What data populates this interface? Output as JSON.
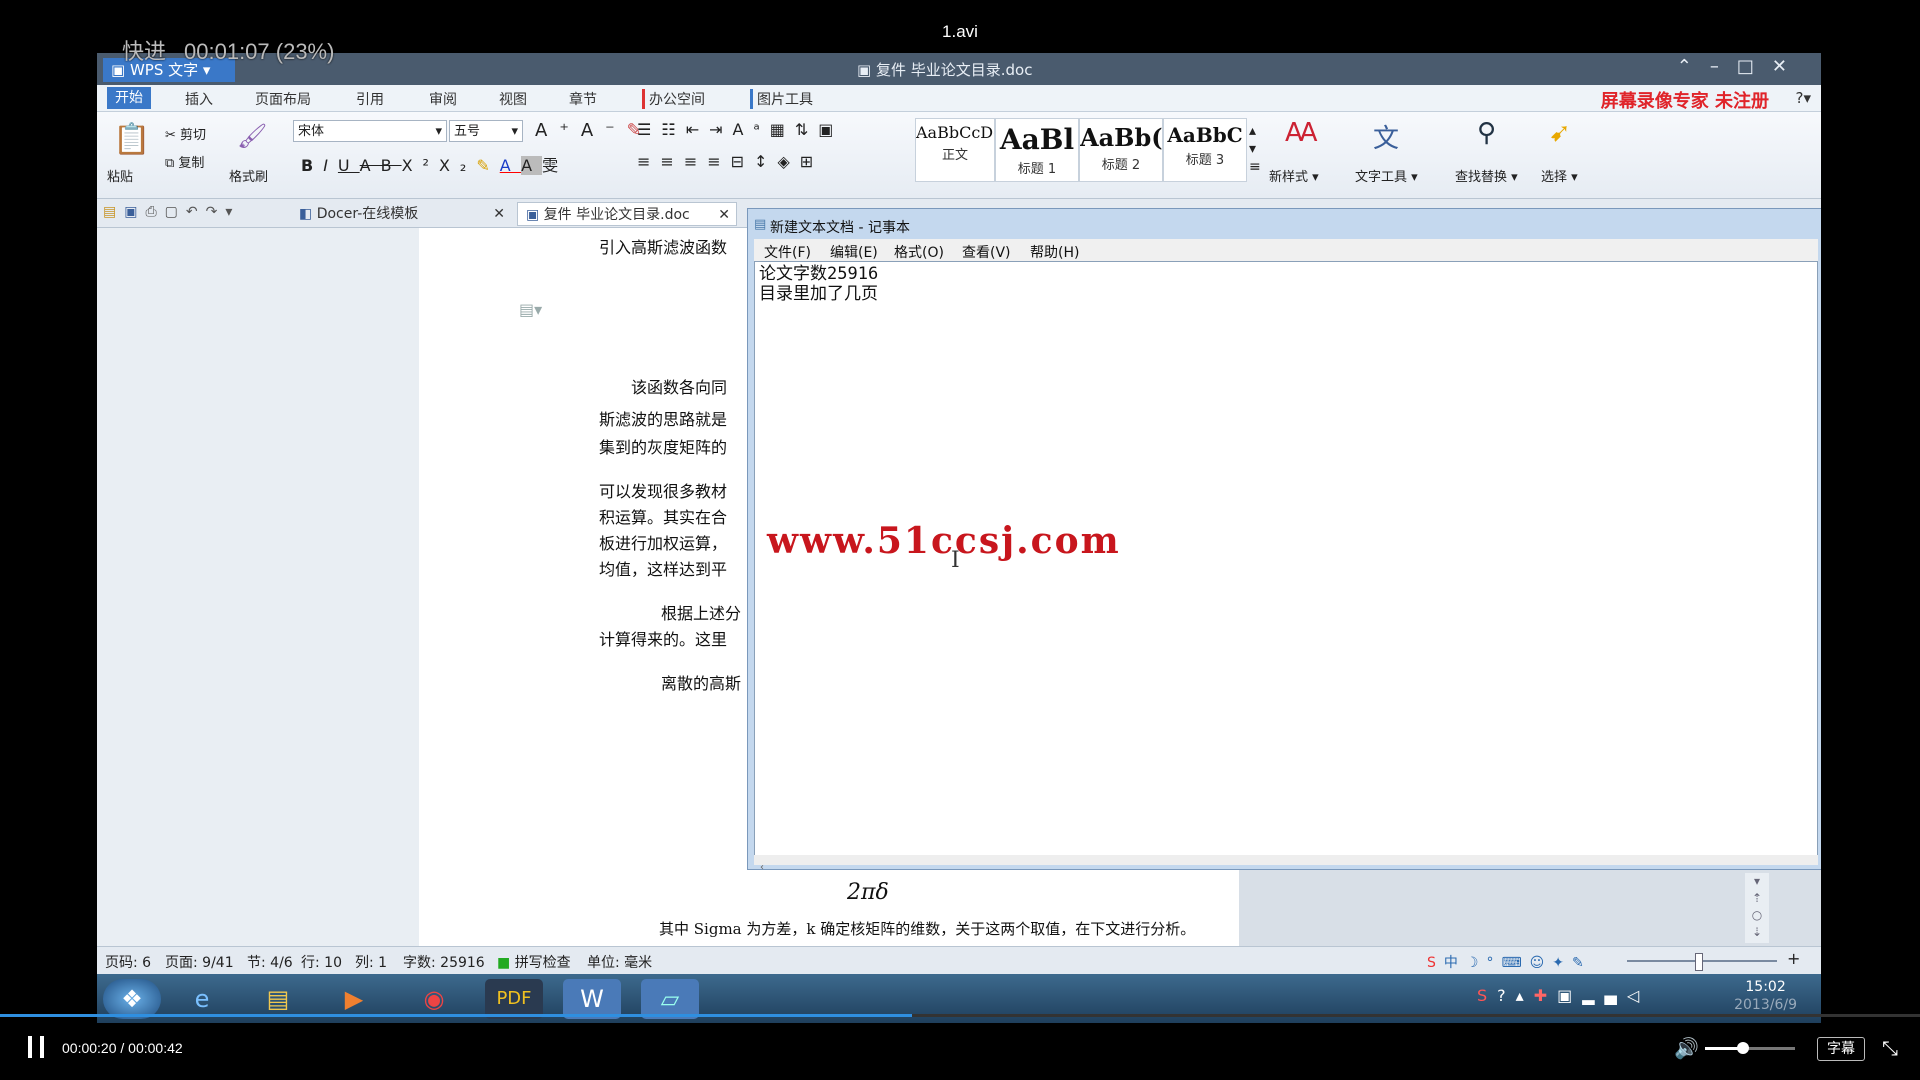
{
  "player": {
    "file_name": "1.avi",
    "speed_label": "快进",
    "speed_time": "00:01:07 (23%)",
    "timecode": "00:00:20 / 00:00:42",
    "progress": 0.475,
    "volume": 0.42,
    "subtitle_label": "字幕"
  },
  "app": {
    "name": "WPS 文字",
    "doc_title": "复件 毕业论文目录.doc",
    "red_banner": "屏幕录像专家 未注册",
    "menus": [
      "开始",
      "插入",
      "页面布局",
      "引用",
      "审阅",
      "视图",
      "章节",
      "办公空间",
      "图片工具"
    ]
  },
  "ribbon": {
    "paste": "粘贴",
    "cut": "剪切",
    "copy": "复制",
    "format_painter": "格式刷",
    "font_name": "宋体",
    "font_size": "五号",
    "styles": [
      {
        "sample": "AaBbCcDd",
        "label": "正文"
      },
      {
        "sample": "AaBl",
        "label": "标题 1"
      },
      {
        "sample": "AaBb(",
        "label": "标题 2"
      },
      {
        "sample": "AaBbC",
        "label": "标题 3"
      }
    ],
    "new_style": "新样式",
    "text_tools": "文字工具",
    "find_replace": "查找替换",
    "select": "选择"
  },
  "tabs": {
    "docer": "Docer-在线模板",
    "document": "复件 毕业论文目录.doc"
  },
  "document_lines": [
    "引入高斯滤波函数",
    "该函数各向同",
    "斯滤波的思路就是",
    "集到的灰度矩阵的",
    "可以发现很多教材",
    "积运算。其实在合",
    "板进行加权运算，",
    "均值，这样达到平",
    "根据上述分",
    "计算得来的。这里",
    "离散的高斯",
    "2πδ",
    "其中 Sigma 为方差，k 确定核矩阵的维数，关于这两个取值，在下文进行分析。"
  ],
  "notepad": {
    "title": "新建文本文档 - 记事本",
    "menus": [
      "文件(F)",
      "编辑(E)",
      "格式(O)",
      "查看(V)",
      "帮助(H)"
    ],
    "line1": "论文字数25916",
    "line2": "目录里加了几页",
    "watermark": "www.51ccsj.com"
  },
  "status": {
    "page": "页码: 6",
    "pages": "页面: 9/41",
    "section": "节: 4/6",
    "row": "行: 10",
    "col": "列: 1",
    "words": "字数: 25916",
    "spell": "拼写检查",
    "unit": "单位: 毫米"
  },
  "taskbar": {
    "time": "15:02",
    "date": "2013/6/9"
  }
}
